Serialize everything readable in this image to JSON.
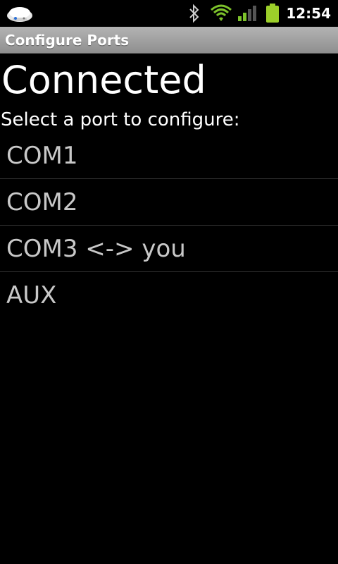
{
  "status_bar": {
    "app_icon": "printer-dome-icon",
    "icons": [
      "bluetooth-icon",
      "wifi-icon",
      "signal-icon",
      "battery-icon"
    ],
    "time": "12:54",
    "battery_color": "#9ccf2a",
    "wifi_color": "#7dc22b"
  },
  "title_bar": {
    "title": "Configure Ports"
  },
  "main": {
    "heading": "Connected",
    "subheading": "Select a port to configure:",
    "ports": [
      {
        "label": "COM1"
      },
      {
        "label": "COM2"
      },
      {
        "label": "COM3 <-> you"
      },
      {
        "label": "AUX"
      }
    ]
  }
}
